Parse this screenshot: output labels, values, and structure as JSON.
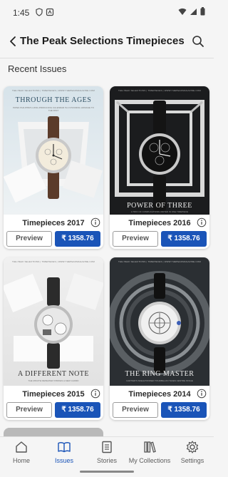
{
  "status_bar": {
    "time": "1:45"
  },
  "header": {
    "title": "The Peak Selections Timepieces"
  },
  "section": {
    "title": "Recent Issues"
  },
  "issues": [
    {
      "title": "Timepieces 2017",
      "preview_label": "Preview",
      "price": "₹ 1358.76",
      "cover_headline": "THROUGH THE AGES",
      "masthead": "THE PEAK SELECTIONS | TIMEPIECES | WWW.THEPEAKMAGAZINE.COM",
      "cover_sub": "PATEK PHILIPPE'S LONG-PRODUCING CALENDAR IS A STUNNING HOMAGE TO THE PAST"
    },
    {
      "title": "Timepieces 2016",
      "preview_label": "Preview",
      "price": "₹ 1358.76",
      "cover_headline": "POWER OF THREE",
      "masthead": "THE PEAK SELECTIONS | TIMEPIECES | WWW.THEPEAKMAGAZINE.COM",
      "cover_sub": "A TRIO OF COMPLICATIONS UNITED IN ONE TIMEPIECE"
    },
    {
      "title": "Timepieces 2015",
      "preview_label": "Preview",
      "price": "₹ 1358.76",
      "cover_headline": "A DIFFERENT NOTE",
      "masthead": "THE PEAK SELECTIONS | TIMEPIECES | WWW.THEPEAKMAGAZINE.COM",
      "cover_sub": "THE MINUTE REPEATER STRIKES A NEW CHORD"
    },
    {
      "title": "Timepieces 2014",
      "preview_label": "Preview",
      "price": "₹ 1358.76",
      "cover_headline": "THE RING MASTER",
      "masthead": "THE PEAK SELECTIONS | TIMEPIECES | WWW.THEPEAKMAGAZINE.COM",
      "cover_sub": "CARTIER'S SKELETONISED TOURBILLON TAKES CENTRE STAGE"
    }
  ],
  "nav": [
    {
      "label": "Home",
      "icon": "home-icon"
    },
    {
      "label": "Issues",
      "icon": "book-open-icon"
    },
    {
      "label": "Stories",
      "icon": "stories-icon"
    },
    {
      "label": "My Collections",
      "icon": "library-icon"
    },
    {
      "label": "Settings",
      "icon": "gear-icon"
    }
  ],
  "colors": {
    "accent": "#1a54b8",
    "background": "#f5f5f5"
  }
}
